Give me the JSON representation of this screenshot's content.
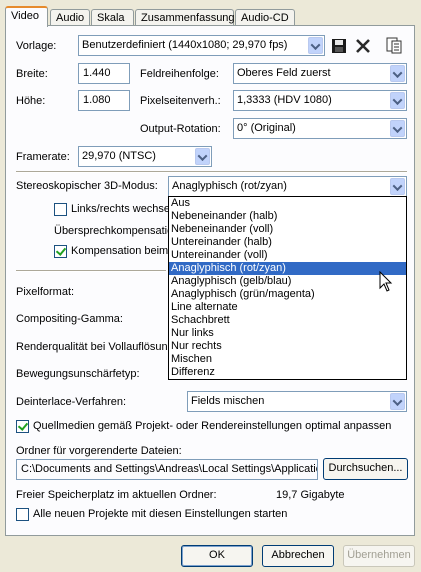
{
  "tabs": [
    "Video",
    "Audio",
    "Skala",
    "Zusammenfassung",
    "Audio-CD"
  ],
  "vorlage": {
    "label": "Vorlage:",
    "value": "Benutzerdefiniert (1440x1080; 29,970 fps)"
  },
  "breite": {
    "label": "Breite:",
    "value": "1.440"
  },
  "hoehe": {
    "label": "Höhe:",
    "value": "1.080"
  },
  "feldreihenfolge": {
    "label": "Feldreihenfolge:",
    "value": "Oberes Feld zuerst"
  },
  "pixelseitenverh": {
    "label": "Pixelseitenverh.:",
    "value": "1,3333 (HDV 1080)"
  },
  "output_rotation": {
    "label": "Output-Rotation:",
    "value": "0° (Original)"
  },
  "framerate": {
    "label": "Framerate:",
    "value": "29,970 (NTSC)"
  },
  "stereo": {
    "label": "Stereoskopischer 3D-Modus:",
    "value": "Anaglyphisch (rot/zyan)",
    "options": [
      "Aus",
      "Nebeneinander (halb)",
      "Nebeneinander (voll)",
      "Untereinander (halb)",
      "Untereinander (voll)",
      "Anaglyphisch (rot/zyan)",
      "Anaglyphisch (gelb/blau)",
      "Anaglyphisch (grün/magenta)",
      "Line alternate",
      "Schachbrett",
      "Nur links",
      "Nur rechts",
      "Mischen",
      "Differenz"
    ],
    "selected_index": 5
  },
  "links_rechts": {
    "label": "Links/rechts wechsel"
  },
  "uebersprech": {
    "label": "Übersprechkompensatio"
  },
  "kompensation": {
    "label": "Kompensation beim R"
  },
  "pixelformat": {
    "label": "Pixelformat:"
  },
  "compositing": {
    "label": "Compositing-Gamma:"
  },
  "renderqualitaet": {
    "label": "Renderqualität bei Vollauflösung"
  },
  "bewegung": {
    "label": "Bewegungsunschärfetyp:"
  },
  "deinterlace": {
    "label": "Deinterlace-Verfahren:",
    "value": "Fields mischen"
  },
  "quellmedien": {
    "label": "Quellmedien gemäß Projekt- oder Rendereinstellungen optimal anpassen"
  },
  "ordner": {
    "label": "Ordner für vorgerenderte Dateien:",
    "value": "C:\\Documents and Settings\\Andreas\\Local Settings\\Applicatio",
    "browse": "Durchsuchen..."
  },
  "speicher": {
    "label": "Freier Speicherplatz im aktuellen Ordner:",
    "value": "19,7 Gigabyte"
  },
  "alle_projekte": {
    "label": "Alle neuen Projekte mit diesen Einstellungen starten"
  },
  "buttons": {
    "ok": "OK",
    "cancel": "Abbrechen",
    "apply": "Übernehmen"
  }
}
